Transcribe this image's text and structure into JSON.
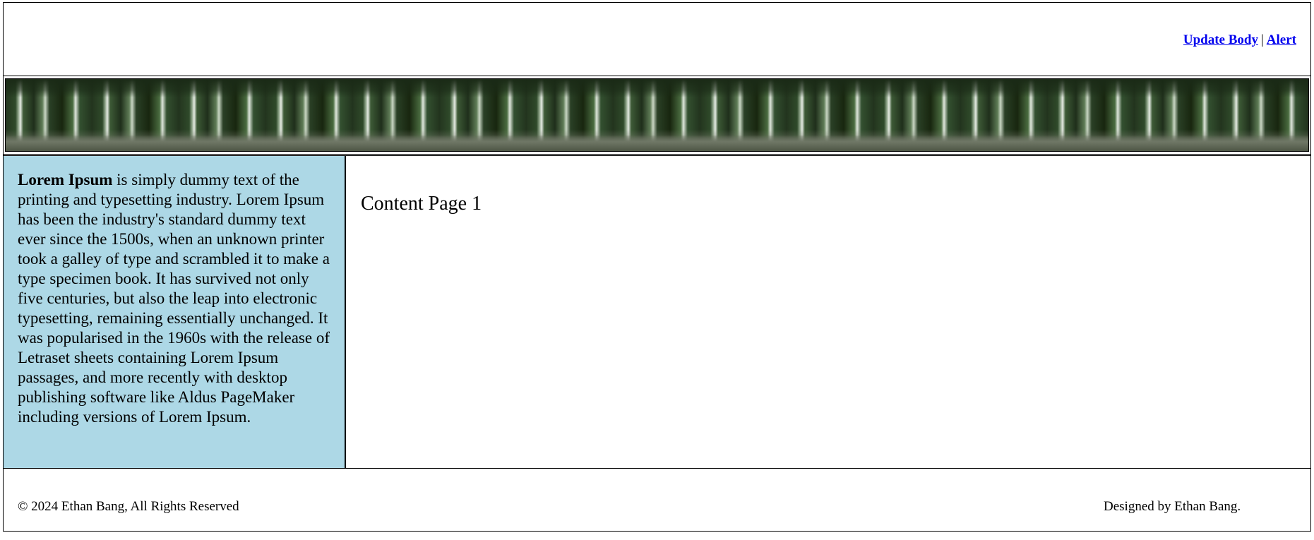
{
  "header": {
    "links": {
      "update_body": "Update Body",
      "separator": "|",
      "alert": "Alert"
    }
  },
  "banner": {
    "description_icon": "forest-banner-image"
  },
  "sidebar": {
    "lead": "Lorem Ipsum",
    "text": " is simply dummy text of the printing and typesetting industry. Lorem Ipsum has been the industry's standard dummy text ever since the 1500s, when an unknown printer took a galley of type and scrambled it to make a type specimen book. It has survived not only five centuries, but also the leap into electronic typesetting, remaining essentially unchanged. It was popularised in the 1960s with the release of Letraset sheets containing Lorem Ipsum passages, and more recently with desktop publishing software like Aldus PageMaker including versions of Lorem Ipsum.",
    "background_color": "#add8e6"
  },
  "main": {
    "heading": "Content Page 1"
  },
  "footer": {
    "copyright": "© 2024 Ethan Bang, All Rights Reserved",
    "designer": "Designed by Ethan Bang."
  },
  "colors": {
    "link": "#0000ee",
    "border": "#000000"
  }
}
